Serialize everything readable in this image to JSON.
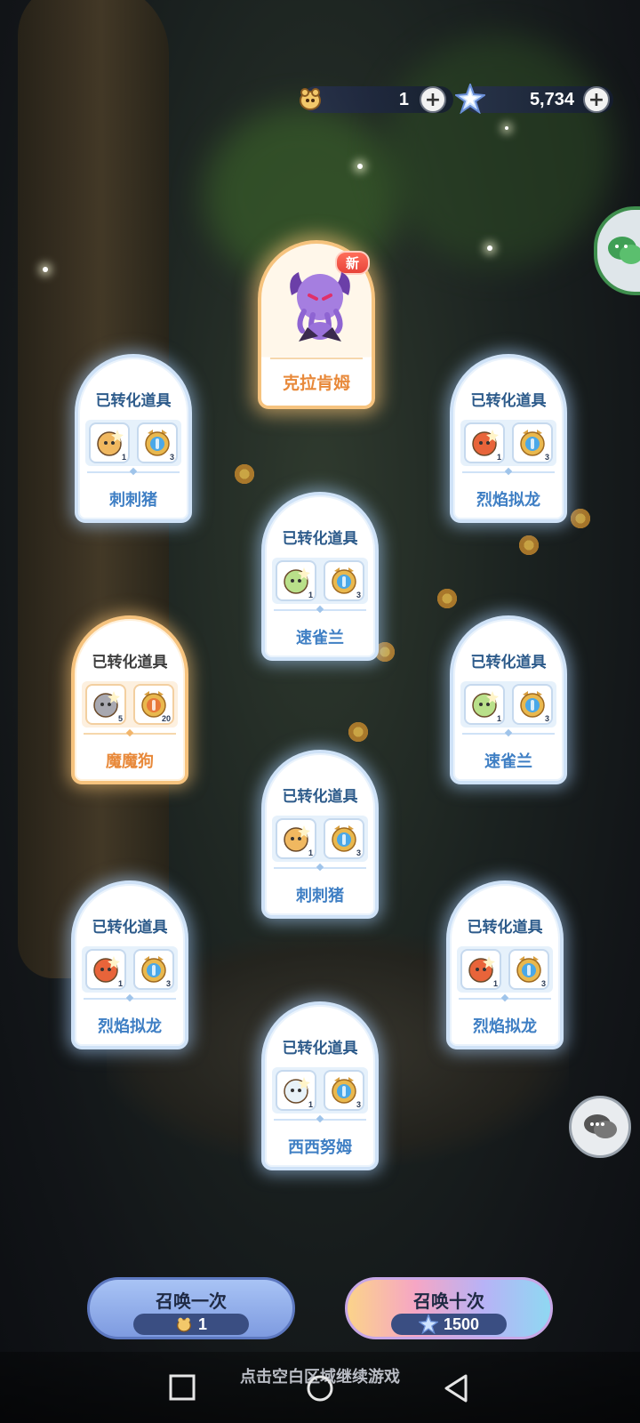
{
  "resources": {
    "ticket": {
      "value": "1",
      "icon": "summon-ticket-icon"
    },
    "star": {
      "value": "5,734",
      "icon": "star-crystal-icon"
    }
  },
  "featured": {
    "name": "克拉肯姆",
    "badge": "新"
  },
  "card_header": "已转化道具",
  "cards": [
    {
      "name": "刺刺猪",
      "items": [
        {
          "count": "1"
        },
        {
          "count": "3"
        }
      ],
      "style": "blue"
    },
    {
      "name": "烈焰拟龙",
      "items": [
        {
          "count": "1"
        },
        {
          "count": "3"
        }
      ],
      "style": "blue"
    },
    {
      "name": "速雀兰",
      "items": [
        {
          "count": "1"
        },
        {
          "count": "3"
        }
      ],
      "style": "blue"
    },
    {
      "name": "魔魔狗",
      "items": [
        {
          "count": "5"
        },
        {
          "count": "20"
        }
      ],
      "style": "gold"
    },
    {
      "name": "速雀兰",
      "items": [
        {
          "count": "1"
        },
        {
          "count": "3"
        }
      ],
      "style": "blue"
    },
    {
      "name": "刺刺猪",
      "items": [
        {
          "count": "1"
        },
        {
          "count": "3"
        }
      ],
      "style": "blue"
    },
    {
      "name": "烈焰拟龙",
      "items": [
        {
          "count": "1"
        },
        {
          "count": "3"
        }
      ],
      "style": "blue"
    },
    {
      "name": "烈焰拟龙",
      "items": [
        {
          "count": "1"
        },
        {
          "count": "3"
        }
      ],
      "style": "blue"
    },
    {
      "name": "西西努姆",
      "items": [
        {
          "count": "1"
        },
        {
          "count": "3"
        }
      ],
      "style": "blue"
    }
  ],
  "buttons": {
    "once": {
      "label": "召唤一次",
      "cost": "1"
    },
    "ten": {
      "label": "召唤十次",
      "cost": "1500"
    }
  },
  "tip": "点击空白区域继续游戏",
  "colors": {
    "blue_frame": "#cfe2f7",
    "gold_frame": "#f6c37e",
    "name_blue": "#3f7fc4",
    "name_gold": "#e8893a"
  }
}
